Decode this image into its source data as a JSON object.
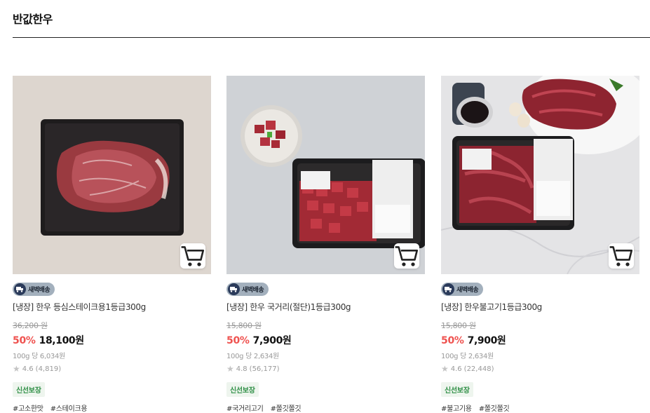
{
  "section": {
    "title": "반값한우"
  },
  "products": [
    {
      "delivery_label": "새벽배송",
      "name": "[냉장] 한우 등심스테이크용1등급300g",
      "original_price": "36,200 원",
      "discount": "50%",
      "price": "18,100원",
      "unit_price": "100g 당 6,034원",
      "rating": "4.6",
      "reviews": "(4,819)",
      "fresh_label": "신선보장",
      "tags": [
        "#고소한맛",
        "#스테이크용"
      ]
    },
    {
      "delivery_label": "새벽배송",
      "name": "[냉장] 한우 국거리(절단)1등급300g",
      "original_price": "15,800 원",
      "discount": "50%",
      "price": "7,900원",
      "unit_price": "100g 당 2,634원",
      "rating": "4.8",
      "reviews": "(56,177)",
      "fresh_label": "신선보장",
      "tags": [
        "#국거리고기",
        "#쫄깃쫄깃"
      ]
    },
    {
      "delivery_label": "새벽배송",
      "name": "[냉장] 한우불고기1등급300g",
      "original_price": "15,800 원",
      "discount": "50%",
      "price": "7,900원",
      "unit_price": "100g 당 2,634원",
      "rating": "4.6",
      "reviews": "(22,448)",
      "fresh_label": "신선보장",
      "tags": [
        "#불고기용",
        "#쫄깃쫄깃"
      ]
    }
  ]
}
